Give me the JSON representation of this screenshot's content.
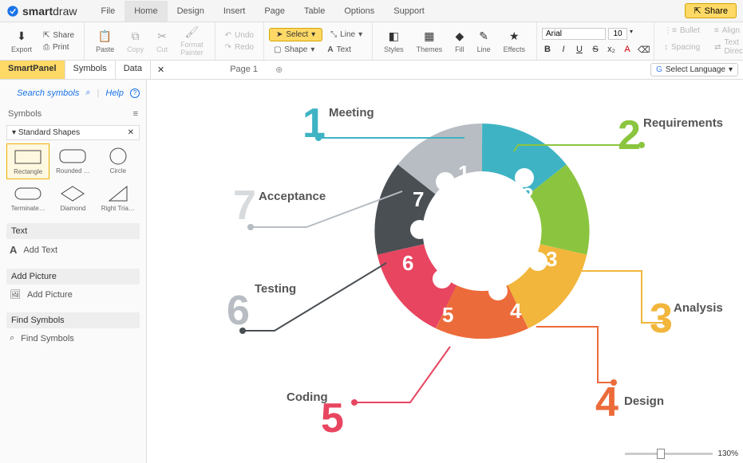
{
  "app": {
    "logo_bold": "smart",
    "logo_light": "draw"
  },
  "menu": [
    "File",
    "Home",
    "Design",
    "Insert",
    "Page",
    "Table",
    "Options",
    "Support"
  ],
  "menu_active": 1,
  "share_label": "Share",
  "ribbon": {
    "export": "Export",
    "share": "Share",
    "print": "Print",
    "paste": "Paste",
    "copy": "Copy",
    "cut": "Cut",
    "format_painter": "Format Painter",
    "undo": "Undo",
    "redo": "Redo",
    "select": "Select",
    "line": "Line",
    "shape": "Shape",
    "text": "Text",
    "styles": "Styles",
    "themes": "Themes",
    "fill": "Fill",
    "line2": "Line",
    "effects": "Effects",
    "font": "Arial",
    "font_size": "10",
    "bullet": "Bullet",
    "align": "Align",
    "spacing": "Spacing",
    "direction": "Text Direction"
  },
  "panel_tabs": [
    "SmartPanel",
    "Symbols",
    "Data"
  ],
  "page_tab": "Page 1",
  "lang_select": "Select Language",
  "sidebar": {
    "search_symbols": "Search symbols",
    "help": "Help",
    "symbols_head": "Symbols",
    "category": "Standard Shapes",
    "shapes": [
      "Rectangle",
      "Rounded …",
      "Circle",
      "Terminate…",
      "Diamond",
      "Right Tria…"
    ],
    "text_head": "Text",
    "add_text": "Add Text",
    "picture_head": "Add Picture",
    "add_picture": "Add Picture",
    "find_head": "Find Symbols",
    "find_symbols": "Find Symbols"
  },
  "diagram": {
    "segments": [
      {
        "n": "1",
        "label": "Meeting",
        "color": "#3eb3c4",
        "num_color": "#3eb3c4"
      },
      {
        "n": "2",
        "label": "Requirements",
        "color": "#8bc53f",
        "num_color": "#8bc53f"
      },
      {
        "n": "3",
        "label": "Analysis",
        "color": "#f2b63c",
        "num_color": "#f2b63c"
      },
      {
        "n": "4",
        "label": "Design",
        "color": "#ec6b3a",
        "num_color": "#ec6b3a"
      },
      {
        "n": "5",
        "label": "Coding",
        "color": "#e84560",
        "num_color": "#e84560"
      },
      {
        "n": "6",
        "label": "Testing",
        "color": "#4a4f54",
        "num_color": "#b7bdc2"
      },
      {
        "n": "7",
        "label": "Acceptance",
        "color": "#b7bdc2",
        "num_color": "#d7dbde"
      }
    ]
  },
  "zoom": "130%"
}
